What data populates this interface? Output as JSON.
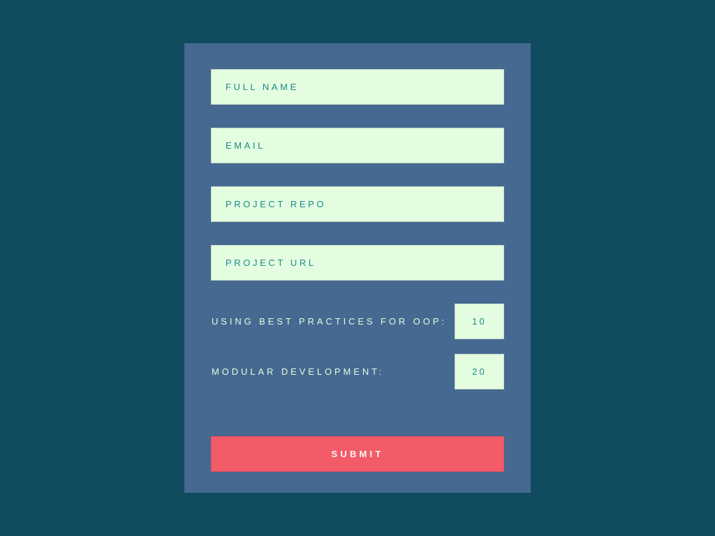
{
  "form": {
    "fields": [
      {
        "placeholder": "FULL NAME",
        "value": ""
      },
      {
        "placeholder": "EMAIL",
        "value": ""
      },
      {
        "placeholder": "PROJECT REPO",
        "value": ""
      },
      {
        "placeholder": "PROJECT URL",
        "value": ""
      }
    ],
    "ratings": [
      {
        "label": "USING BEST PRACTICES FOR OOP:",
        "value": "10"
      },
      {
        "label": "MODULAR DEVELOPMENT:",
        "value": "20"
      }
    ],
    "submit_label": "SUBMIT"
  },
  "colors": {
    "background": "#114b5f",
    "card": "#456990",
    "field": "#e4fde1",
    "field_text": "#1a8b8a",
    "label_text": "#e4fde1",
    "submit": "#f45b69"
  }
}
